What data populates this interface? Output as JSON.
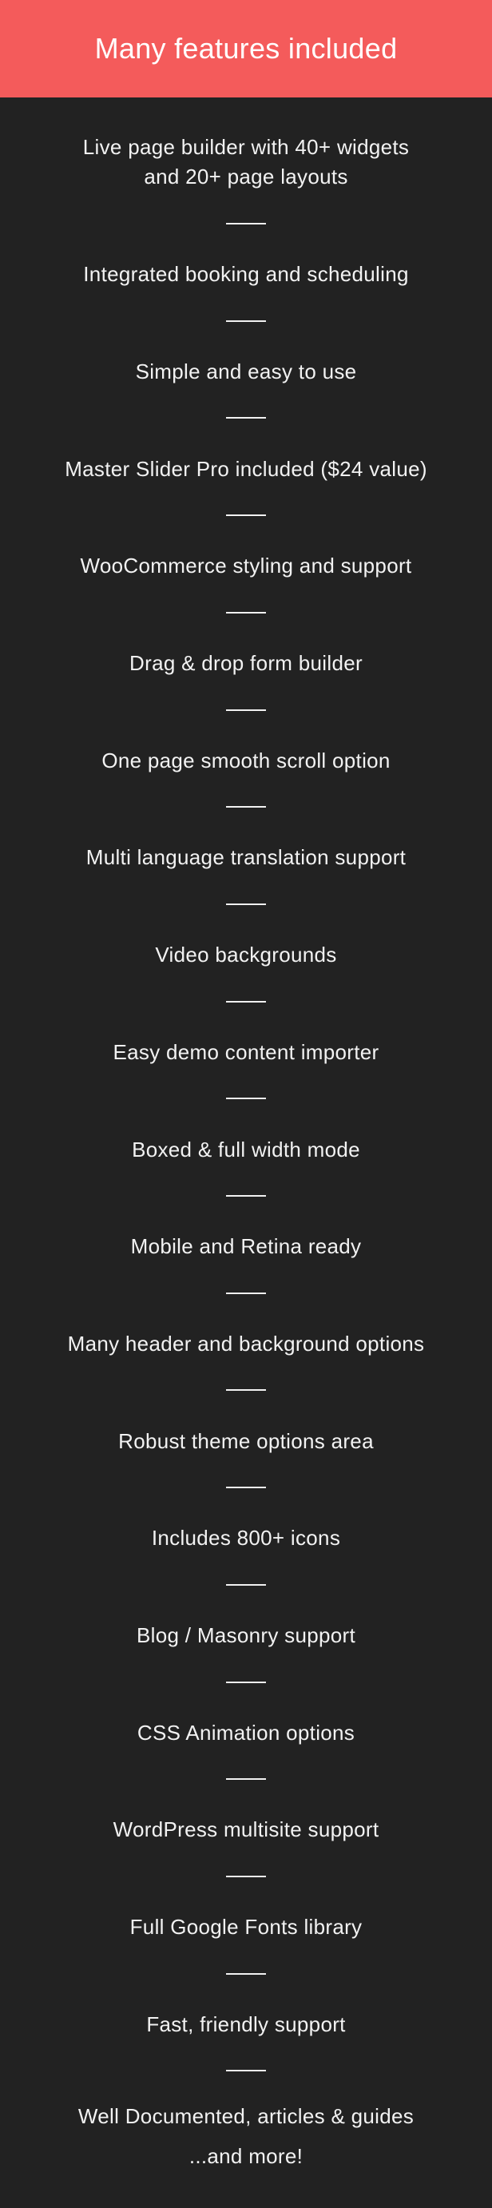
{
  "header": {
    "title": "Many features included",
    "background": "#f45b5b"
  },
  "features": [
    [
      "Live page builder with 40+ widgets",
      "and 20+ page layouts"
    ],
    [
      "Integrated booking and scheduling"
    ],
    [
      "Simple and easy to use"
    ],
    [
      "Master Slider Pro included ($24 value)"
    ],
    [
      "WooCommerce styling and support"
    ],
    [
      "Drag & drop form builder"
    ],
    [
      "One page smooth scroll option"
    ],
    [
      "Multi language translation support"
    ],
    [
      "Video backgrounds"
    ],
    [
      "Easy demo content importer"
    ],
    [
      "Boxed & full width mode"
    ],
    [
      "Mobile and Retina ready"
    ],
    [
      "Many header and background options"
    ],
    [
      "Robust theme options area"
    ],
    [
      "Includes 800+ icons"
    ],
    [
      "Blog / Masonry support"
    ],
    [
      "CSS Animation options"
    ],
    [
      "WordPress multisite support"
    ],
    [
      "Full Google Fonts library"
    ],
    [
      "Fast, friendly support"
    ],
    [
      "Well Documented, articles & guides",
      "...and more!"
    ]
  ]
}
